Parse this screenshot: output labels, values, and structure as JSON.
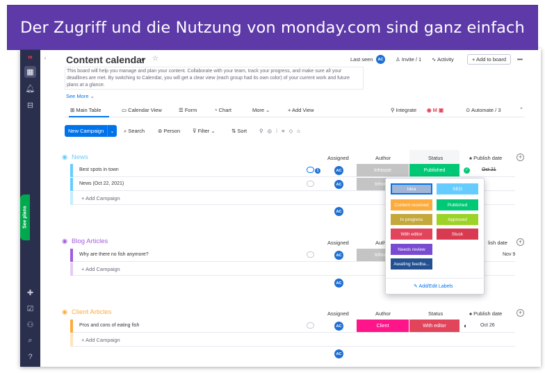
{
  "banner": {
    "text": "Der Zugriff und die Nutzung von monday.com sind ganz einfach"
  },
  "sidebar": {
    "see_plans": "See plans"
  },
  "board": {
    "title": "Content calendar",
    "description": "This board will help you manage and plan your content. Collaborate with your team, track your progress, and make sure all your deadlines are met. By switching to Calendar, you will get a clear view (each group had its own color) of your current work and future plans at a glance.",
    "see_more": "See More ⌄",
    "last_seen": "Last seen",
    "invite": "Invite / 1",
    "activity": "Activity",
    "add_to_board": "+ Add to board",
    "more_menu": "•••"
  },
  "tabs": [
    {
      "label": "Main Table",
      "icon": "table-icon"
    },
    {
      "label": "Calendar View",
      "icon": "calendar-icon"
    },
    {
      "label": "Form",
      "icon": "form-icon"
    },
    {
      "label": "Chart",
      "icon": "chart-icon"
    },
    {
      "label": "More ⌄"
    },
    {
      "label": "+ Add View"
    }
  ],
  "integrate": "Integrate",
  "automate": "Automate / 3",
  "toolbar": {
    "new_campaign": "New Campaign",
    "search": "Search",
    "person": "Person",
    "filter": "Filter",
    "sort": "Sort"
  },
  "columns": {
    "assigned": "Assigned",
    "author": "Author",
    "status": "Status",
    "publish_date": "Publish date"
  },
  "author_cut": "Auth",
  "publish_cut": "lish date",
  "avatar_initials": "AC",
  "add_campaign": "+ Add Campaign",
  "groups": [
    {
      "name": "News",
      "color": "#66ccff",
      "rows": [
        {
          "name": "Best spots in town",
          "author": "Inhouse",
          "status": "Published",
          "date": "Oct 21"
        },
        {
          "name": "News (Oct 22, 2021)",
          "author": "Inhou",
          "status": "",
          "date": ""
        }
      ]
    },
    {
      "name": "Blog Articles",
      "color": "#a25ddc",
      "rows": [
        {
          "name": "Why are there no fish anymore?",
          "author": "Inhou",
          "status": "",
          "date": "Nov 9"
        }
      ]
    },
    {
      "name": "Client Articles",
      "color": "#fdab3d",
      "rows": [
        {
          "name": "Pros and cons of eating fish",
          "author": "Client",
          "status": "With editor",
          "date": "Oct 26"
        }
      ]
    }
  ],
  "status_labels": [
    {
      "label": "Idea",
      "color": "#a1b5d6"
    },
    {
      "label": "SEO",
      "color": "#66ccff"
    },
    {
      "label": "Content received",
      "color": "#fdab3d"
    },
    {
      "label": "Published",
      "color": "#00c875"
    },
    {
      "label": "In progress",
      "color": "#c4a83c"
    },
    {
      "label": "Approved",
      "color": "#9cd326"
    },
    {
      "label": "With editor",
      "color": "#e2445c"
    },
    {
      "label": "Stuck",
      "color": "#d83a52"
    },
    {
      "label": "Needs review",
      "color": "#784bd1"
    },
    {
      "label": "Awaiting feedba...",
      "color": "#225091"
    }
  ],
  "add_edit_labels": "Add/Edit Labels",
  "colors": {
    "accent": "#0073ea",
    "sidebar": "#292f4c",
    "banner": "#5d3aa8",
    "author_grey": "#c4c4c4",
    "client_pink": "#ff158a",
    "editor_pink": "#e2445c"
  }
}
